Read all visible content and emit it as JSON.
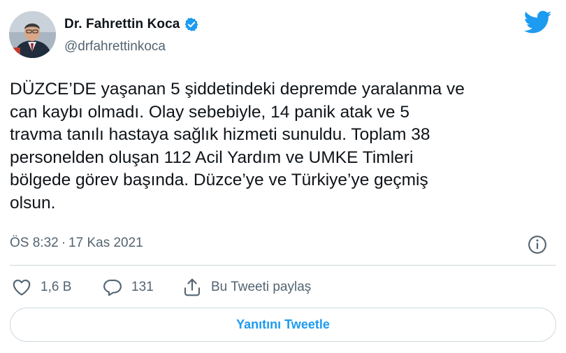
{
  "user": {
    "display_name": "Dr. Fahrettin Koca",
    "handle": "@drfahrettinkoca",
    "verified": true
  },
  "tweet": {
    "text": "DÜZCE’DE yaşanan 5 şiddetindeki depremde yaralanma ve\ncan kaybı olmadı. Olay sebebiyle, 14 panik atak ve 5\ntravma tanılı hastaya sağlık hizmeti sunuldu. Toplam 38\npersonelden oluşan 112 Acil Yardım ve UMKE Timleri\nbölgede görev başında. Düzce’ye ve Türkiye’ye geçmiş\nolsun.",
    "time": "ÖS 8:32",
    "separator": "·",
    "date": "17 Kas 2021"
  },
  "actions": {
    "like_count": "1,6 B",
    "reply_count": "131",
    "share_label": "Bu Tweeti paylaş"
  },
  "reply_button_label": "Yanıtını Tweetle",
  "icons": {
    "brand": "twitter-bird-icon",
    "verified": "verified-badge-icon",
    "info": "info-icon",
    "like": "heart-icon",
    "reply": "reply-bubble-icon",
    "share": "share-icon"
  },
  "colors": {
    "accent": "#1d9bf0",
    "text": "#0f1419",
    "muted": "#536471",
    "border": "#cfd9de"
  }
}
